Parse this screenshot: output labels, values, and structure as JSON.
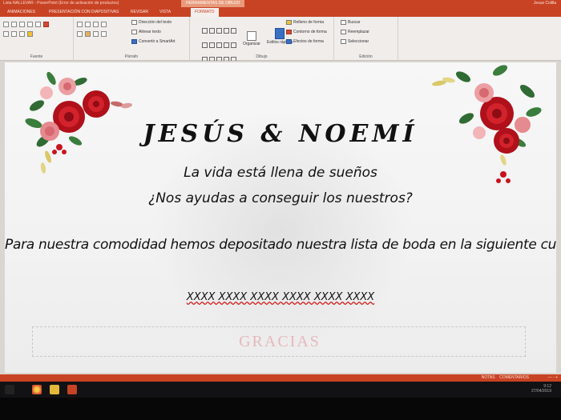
{
  "window": {
    "title": "Lista NALLEVAR - PowerPoint (Error de activación de productos)",
    "tools_header": "HERRAMIENTAS DE DIBUJO",
    "user": "Jesus Colilla"
  },
  "tabs": [
    {
      "label": "ANIMACIONES"
    },
    {
      "label": "PRESENTACIÓN CON DIAPOSITIVAS"
    },
    {
      "label": "REVISAR"
    },
    {
      "label": "VISTA"
    },
    {
      "label": "FORMATO"
    }
  ],
  "ribbon": {
    "groups": [
      {
        "label": "Fuente"
      },
      {
        "label": "Párrafo"
      },
      {
        "label": "Dibujo"
      },
      {
        "label": "Edición"
      }
    ],
    "paragraph": {
      "text_direction": "Dirección del texto",
      "align_text": "Alinear texto",
      "smartart": "Convertir a SmartArt"
    },
    "drawing": {
      "arrange": "Organizar",
      "quick_styles": "Estilos rápidos",
      "shape_fill": "Relleno de forma",
      "shape_outline": "Contorno de forma",
      "shape_effects": "Efectos de forma"
    },
    "editing": {
      "find": "Buscar",
      "replace": "Reemplazar",
      "select": "Seleccionar"
    }
  },
  "slide": {
    "names": "JESÚS & NOEMÍ",
    "line1": "La vida está llena de sueños",
    "line2": "¿Nos ayudas a conseguir los nuestros?",
    "line3": "Para nuestra comodidad hemos depositado nuestra lista de boda en la siguiente cuenta bancaria",
    "account": "XXXX XXXX XXXX XXXX XXXX XXXX",
    "thanks": "GRACIAS"
  },
  "status": {
    "notes": "NOTAS",
    "comments": "COMENTARIOS"
  },
  "taskbar": {
    "time": "9:12",
    "date": "27/04/2019"
  },
  "colors": {
    "accent": "#c84324",
    "rose": "#c8141e",
    "thanks": "#e6b8bd"
  }
}
